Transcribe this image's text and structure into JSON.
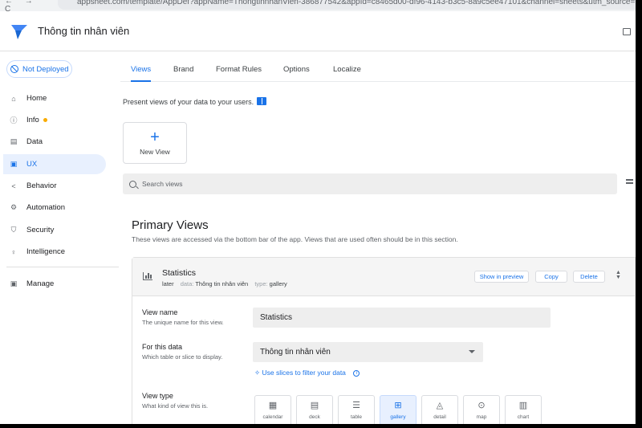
{
  "browser": {
    "nav": "← → C",
    "url": "appsheet.com/template/AppDef?appName=ThongtinnhanVien-386877542&appId=c8465d00-df96-4143-b3c5-8a9c5ee47101&channel=sheets&utm_source="
  },
  "app": {
    "title": "Thông tin nhân viên"
  },
  "sidebar": {
    "deploy_label": "Not Deployed",
    "items": [
      {
        "label": "Home",
        "icon": "home-icon",
        "glyph": "⌂"
      },
      {
        "label": "Info",
        "icon": "info-icon",
        "glyph": "ⓘ"
      },
      {
        "label": "Data",
        "icon": "data-icon",
        "glyph": "▤"
      },
      {
        "label": "UX",
        "icon": "ux-icon",
        "glyph": "▣"
      },
      {
        "label": "Behavior",
        "icon": "behavior-icon",
        "glyph": "<"
      },
      {
        "label": "Automation",
        "icon": "automation-icon",
        "glyph": "⚙"
      },
      {
        "label": "Security",
        "icon": "shield-icon",
        "glyph": "⛉"
      },
      {
        "label": "Intelligence",
        "icon": "bulb-icon",
        "glyph": "♀"
      },
      {
        "label": "Manage",
        "icon": "manage-icon",
        "glyph": "▣"
      }
    ]
  },
  "tabs": [
    "Views",
    "Brand",
    "Format Rules",
    "Options",
    "Localize"
  ],
  "intro": "Present views of your data to your users.",
  "new_view": {
    "label": "New View",
    "glyph": "+"
  },
  "search": {
    "placeholder": "Search views"
  },
  "primary": {
    "title": "Primary Views",
    "description": "These views are accessed via the bottom bar of the app. Views that are used often should be in this section."
  },
  "view": {
    "name": "Statistics",
    "position": "later",
    "data_key": "data:",
    "data_value": "Thông tin nhân viên",
    "type_key": "type:",
    "type_value": "gallery",
    "actions": [
      "Show in preview",
      "Copy",
      "Delete"
    ],
    "fields": {
      "name_label": "View name",
      "name_help": "The unique name for this view.",
      "name_value": "Statistics",
      "data_label": "For this data",
      "data_help": "Which table or slice to display.",
      "data_value": "Thông tin nhân viên",
      "slices_link": "Use slices to filter your data",
      "type_label": "View type",
      "type_help": "What kind of view this is."
    },
    "view_types": [
      {
        "label": "calendar",
        "glyph": "▦",
        "icon": "calendar-icon"
      },
      {
        "label": "deck",
        "glyph": "▤",
        "icon": "deck-icon"
      },
      {
        "label": "table",
        "glyph": "☰",
        "icon": "table-icon"
      },
      {
        "label": "gallery",
        "glyph": "⊞",
        "icon": "gallery-icon"
      },
      {
        "label": "detail",
        "glyph": "◬",
        "icon": "detail-icon"
      },
      {
        "label": "map",
        "glyph": "⊙",
        "icon": "map-pin-icon"
      },
      {
        "label": "chart",
        "glyph": "▥",
        "icon": "chart-icon"
      }
    ]
  },
  "colors": {
    "accent": "#1a73e8",
    "active_bg": "#e8f0fe",
    "status_dot": "#f9ab00"
  }
}
